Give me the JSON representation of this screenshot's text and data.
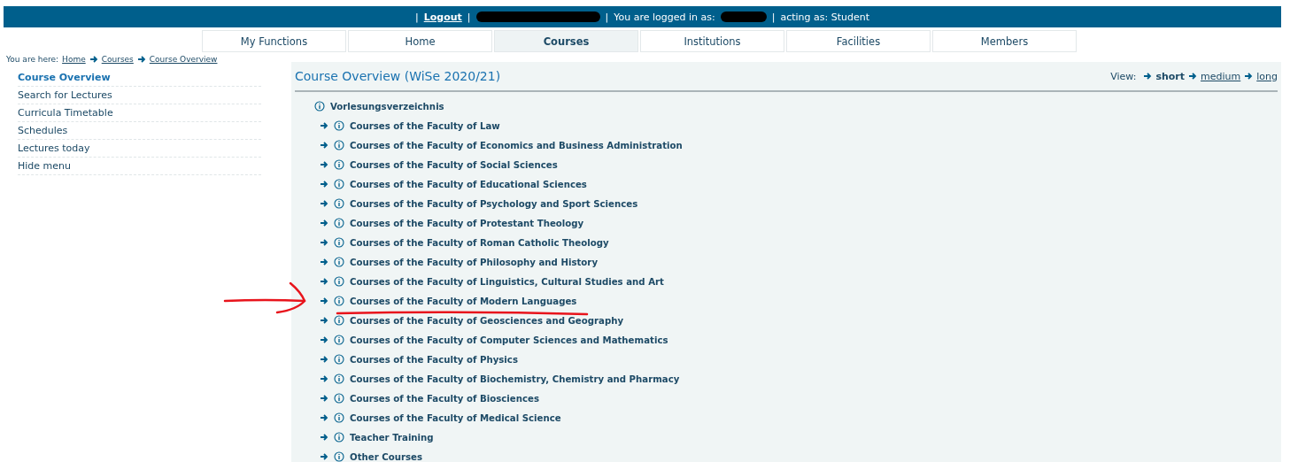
{
  "top_bar": {
    "logout": "Logout",
    "logged_in_label": "You are logged in as:",
    "acting_as": "acting as: Student",
    "separator": "|"
  },
  "tabs": [
    {
      "label": "My Functions",
      "selected": false
    },
    {
      "label": "Home",
      "selected": false
    },
    {
      "label": "Courses",
      "selected": true
    },
    {
      "label": "Institutions",
      "selected": false
    },
    {
      "label": "Facilities",
      "selected": false
    },
    {
      "label": "Members",
      "selected": false
    }
  ],
  "breadcrumb": {
    "label": "You are here:",
    "items": [
      "Home",
      "Courses",
      "Course Overview"
    ]
  },
  "sidebar": {
    "items": [
      {
        "label": "Course Overview",
        "selected": true
      },
      {
        "label": "Search for Lectures",
        "selected": false
      },
      {
        "label": "Curricula Timetable",
        "selected": false
      },
      {
        "label": "Schedules",
        "selected": false
      },
      {
        "label": "Lectures today",
        "selected": false
      },
      {
        "label": "Hide menu",
        "selected": false
      }
    ]
  },
  "content": {
    "title": "Course Overview (WiSe 2020/21)",
    "view_label": "View:",
    "view_options": [
      {
        "label": "short",
        "selected": true
      },
      {
        "label": "medium",
        "selected": false
      },
      {
        "label": "long",
        "selected": false
      }
    ],
    "tree": {
      "label": "Vorlesungsverzeichnis",
      "children": [
        {
          "label": "Courses of the Faculty of Law"
        },
        {
          "label": "Courses of the Faculty of Economics and Business Administration"
        },
        {
          "label": "Courses of the Faculty of Social Sciences"
        },
        {
          "label": "Courses of the Faculty of Educational Sciences"
        },
        {
          "label": "Courses of the Faculty of Psychology and Sport Sciences"
        },
        {
          "label": "Courses of the Faculty of Protestant Theology"
        },
        {
          "label": "Courses of the Faculty of Roman Catholic Theology"
        },
        {
          "label": "Courses of the Faculty of Philosophy and History"
        },
        {
          "label": "Courses of the Faculty of Linguistics, Cultural Studies and Art"
        },
        {
          "label": "Courses of the Faculty of Modern Languages"
        },
        {
          "label": "Courses of the Faculty of Geosciences and Geography"
        },
        {
          "label": "Courses of the Faculty of Computer Sciences and Mathematics"
        },
        {
          "label": "Courses of the Faculty of Physics"
        },
        {
          "label": "Courses of the Faculty of Biochemistry, Chemistry and Pharmacy"
        },
        {
          "label": "Courses of the Faculty of Biosciences"
        },
        {
          "label": "Courses of the Faculty of Medical Science"
        },
        {
          "label": "Teacher Training"
        },
        {
          "label": "Other Courses"
        }
      ]
    }
  }
}
